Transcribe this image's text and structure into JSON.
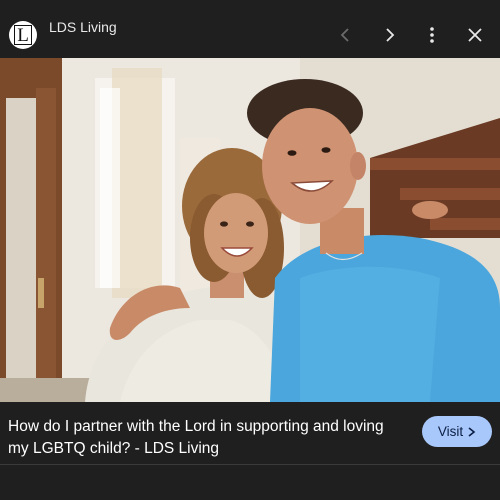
{
  "header": {
    "logo_letter": "L",
    "site_name": "LDS Living"
  },
  "toolbar": {
    "prev_icon": "chevron-left-icon",
    "next_icon": "chevron-right-icon",
    "more_icon": "more-vert-icon",
    "close_icon": "close-icon"
  },
  "image": {
    "subject": "photo of a smiling mother and teenage son embracing indoors"
  },
  "caption": {
    "text": "How do I partner with the Lord in supporting and loving my LGBTQ child? - LDS Living",
    "visit_label": "Visit",
    "visit_icon": "chevron-right-icon"
  },
  "colors": {
    "background": "#1f1f1f",
    "visit_button": "#a8c7fa"
  }
}
